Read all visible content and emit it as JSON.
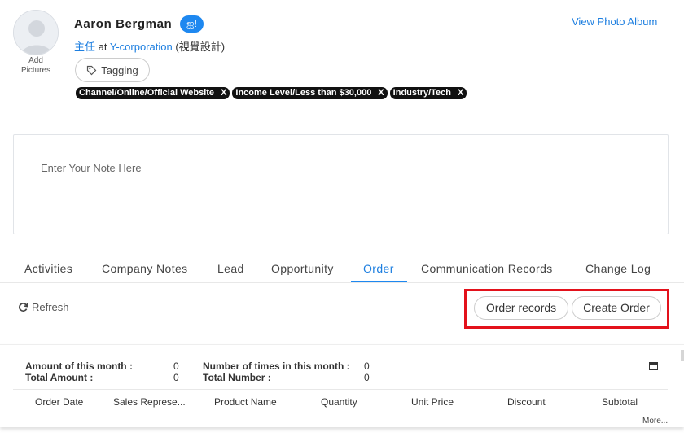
{
  "profile": {
    "name": "Aaron Bergman",
    "chat_badge": "ஐ!",
    "add_pictures": "Add Pictures",
    "title": "主任",
    "at": "at",
    "company": "Y-corporation",
    "department": "(視覺設計)",
    "tagging_label": "Tagging",
    "view_album": "View Photo Album"
  },
  "tags": [
    {
      "label": "Channel/Online/Official Website",
      "remove": "X"
    },
    {
      "label": "Income Level/Less than $30,000",
      "remove": "X"
    },
    {
      "label": "Industry/Tech",
      "remove": "X"
    }
  ],
  "note": {
    "placeholder": "Enter Your Note Here"
  },
  "tabs": [
    {
      "label": "Activities"
    },
    {
      "label": "Company Notes"
    },
    {
      "label": "Lead"
    },
    {
      "label": "Opportunity"
    },
    {
      "label": "Order",
      "active": true
    },
    {
      "label": "Communication Records"
    },
    {
      "label": "Change Log"
    }
  ],
  "toolbar": {
    "refresh_label": "Refresh",
    "order_records_label": "Order records",
    "create_order_label": "Create Order"
  },
  "summary": {
    "amount_month_label": "Amount of this month :",
    "amount_month_value": "0",
    "total_amount_label": "Total Amount :",
    "total_amount_value": "0",
    "times_month_label": "Number of times in this month :",
    "times_month_value": "0",
    "total_number_label": "Total Number :",
    "total_number_value": "0"
  },
  "table": {
    "columns": [
      "Order Date",
      "Sales Represe...",
      "Product Name",
      "Quantity",
      "Unit Price",
      "Discount",
      "Subtotal"
    ],
    "more_label": "More..."
  },
  "colors": {
    "accent": "#1e88f0",
    "link": "#1e7fe0",
    "highlight": "#e3111b",
    "tag_bg": "#111111"
  },
  "icons": [
    "avatar-placeholder-icon",
    "chat-icon",
    "tag-icon",
    "refresh-icon",
    "window-icon"
  ]
}
